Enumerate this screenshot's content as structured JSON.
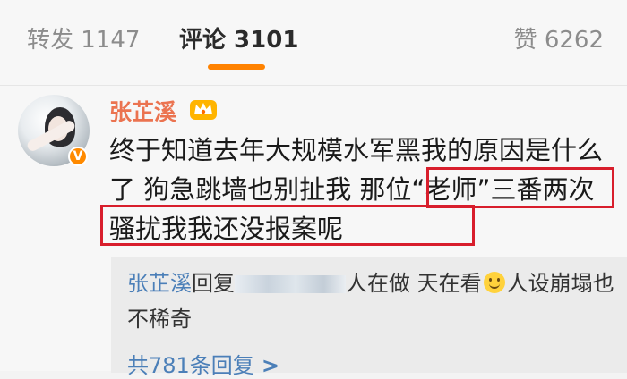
{
  "tabs": {
    "reposts": "转发 1147",
    "comments": "评论 3101",
    "likes": "赞 6262"
  },
  "colors": {
    "accent": "#ff8200",
    "username": "#eb7350",
    "link": "#4b7fb8",
    "highlight": "#d81e2c"
  },
  "comment": {
    "username": "张芷溪",
    "text": "终于知道去年大规模水军黑我的原因是什么了 狗急跳墙也别扯我 那位“老师”三番两次骚扰我我还没报案呢",
    "badge_icon": "verified-v-icon",
    "vip_icon": "crown-icon"
  },
  "reply": {
    "author": "张芷溪",
    "reply_word": "回复",
    "text_a": "人在做 天在看",
    "emoji_icon": "smile-icon",
    "text_b": "人设崩塌也不稀奇"
  },
  "reply_count": {
    "label": "共781条回复"
  }
}
